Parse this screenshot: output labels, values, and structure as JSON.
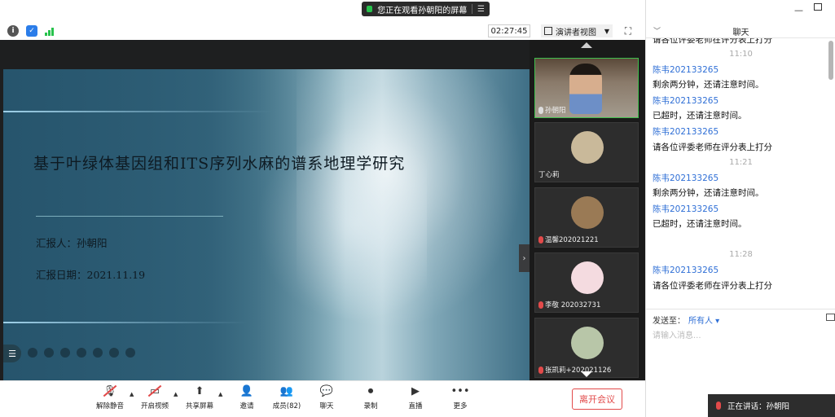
{
  "banner": {
    "text": "您正在观看孙朝阳的屏幕"
  },
  "toolbar": {
    "timer": "02:27:45",
    "view_mode": "演讲者视图"
  },
  "colors": {
    "accent": "#2f6fd6",
    "danger": "#e24a4a",
    "active_speaker": "#3fbf4c"
  },
  "slide": {
    "title": "基于叶绿体基因组和ITS序列水麻的谱系地理学研究",
    "reporter": "汇报人：孙朝阳",
    "date": "汇报日期：2021.11.19"
  },
  "participants": [
    {
      "name": "孙朝阳",
      "muted": false
    },
    {
      "name": "丁心莉",
      "muted": false
    },
    {
      "name": "温馨202021221",
      "muted": true
    },
    {
      "name": "李敬 202032731",
      "muted": true
    },
    {
      "name": "张凯莉+202021126",
      "muted": true
    }
  ],
  "bottombar": {
    "unmute": "解除静音",
    "video": "开启视频",
    "share": "共享屏幕",
    "invite": "邀请",
    "members": "成员(82)",
    "chat": "聊天",
    "record": "录制",
    "live": "直播",
    "more": "更多",
    "leave": "离开会议"
  },
  "chat": {
    "title": "聊天",
    "top_partial": "请各位评委老师在评分表上打分",
    "entries": [
      {
        "time": "11:10"
      },
      {
        "sender": "陈韦202133265",
        "message": "剩余两分钟，还请注意时间。"
      },
      {
        "sender": "陈韦202133265",
        "message": "已超时，还请注意时间。"
      },
      {
        "sender": "陈韦202133265",
        "message": "请各位评委老师在评分表上打分"
      },
      {
        "time": "11:21"
      },
      {
        "sender": "陈韦202133265",
        "message": "剩余两分钟，还请注意时间。"
      },
      {
        "sender": "陈韦202133265",
        "message": "已超时，还请注意时间。"
      },
      {
        "time": "11:28"
      },
      {
        "sender": "陈韦202133265",
        "message": "请各位评委老师在评分表上打分"
      }
    ],
    "send_to_label": "发送至：",
    "send_to_value": "所有人 ▾",
    "input_placeholder": "请输入消息..."
  },
  "toast": {
    "speaking": "正在讲话：孙朝阳"
  },
  "icons": [
    "info-icon",
    "shield-icon",
    "signal-icon",
    "fullscreen-icon",
    "mic-off-icon",
    "video-off-icon",
    "share-screen-icon",
    "invite-icon",
    "members-icon",
    "chat-icon",
    "record-icon",
    "live-icon",
    "more-icon",
    "image-icon"
  ]
}
